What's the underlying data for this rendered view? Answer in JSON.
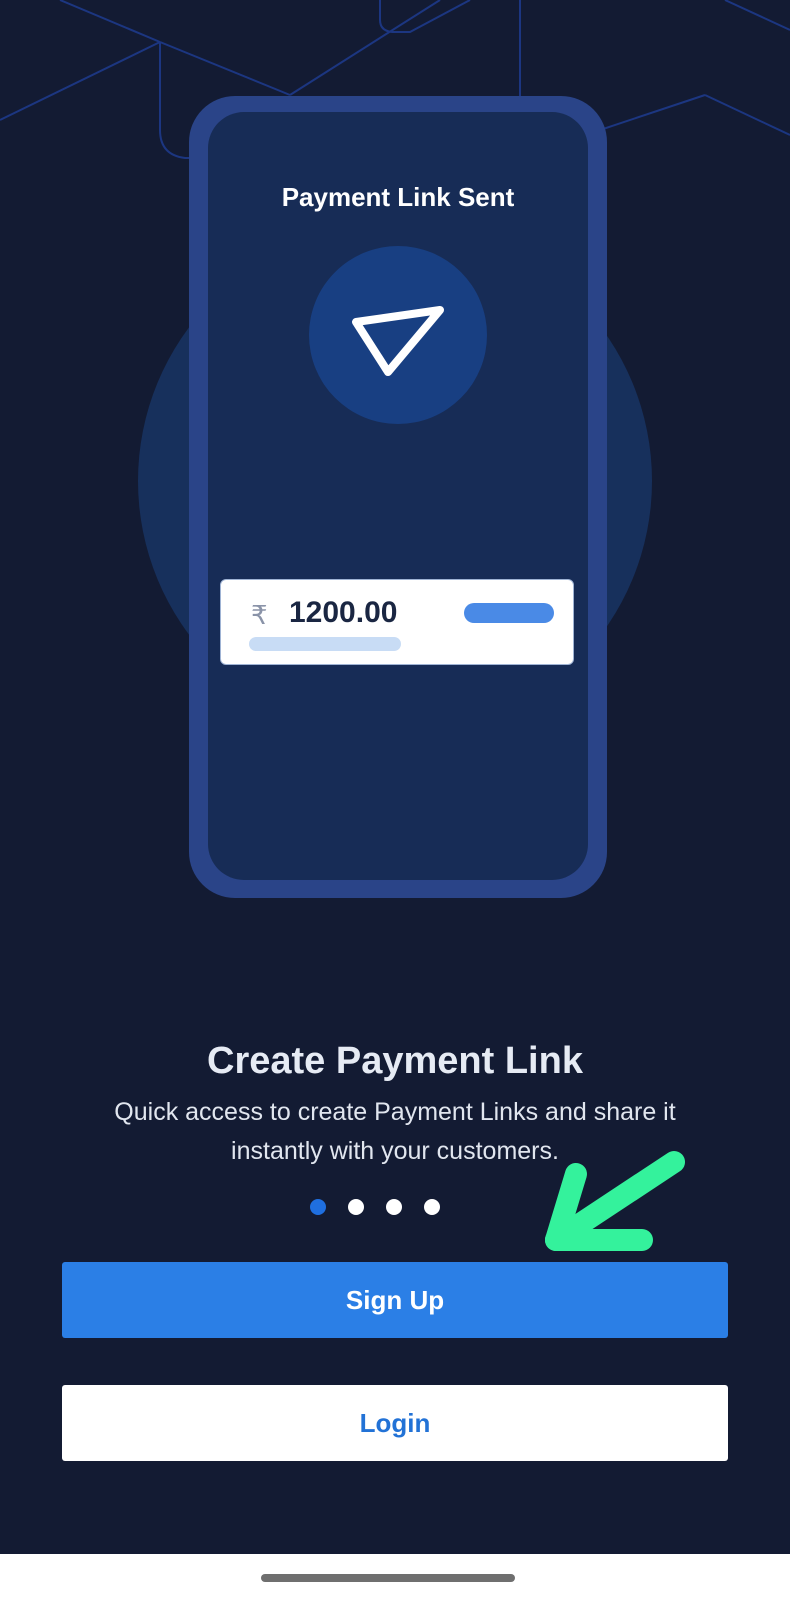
{
  "illustration": {
    "phone_title": "Payment Link Sent",
    "currency_symbol": "₹",
    "amount": "1200.00"
  },
  "onboarding": {
    "headline": "Create Payment Link",
    "description": "Quick access to create Payment Links and share it instantly with your customers.",
    "page_indicator": {
      "total": 4,
      "active_index": 0
    }
  },
  "actions": {
    "signup_label": "Sign Up",
    "login_label": "Login"
  },
  "colors": {
    "background": "#131b33",
    "primary_button": "#2b7fe6",
    "active_dot": "#1f6fe0",
    "annotation_arrow": "#34f29c"
  },
  "icons": {
    "send": "send-icon",
    "annotation": "arrow-annotation"
  }
}
